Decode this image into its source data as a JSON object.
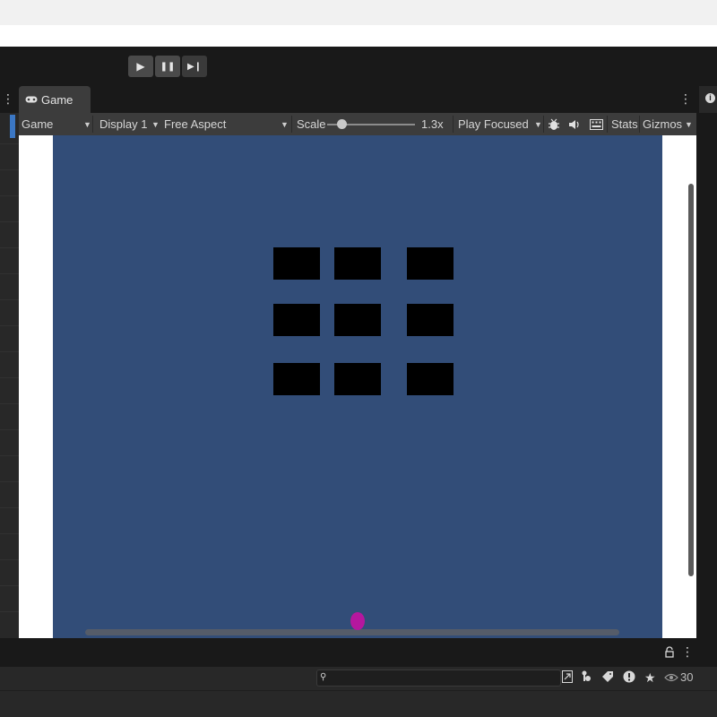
{
  "play_controls": {
    "play": "▶",
    "pause": "❚❚",
    "step": "▶❙"
  },
  "tab": {
    "label": "Game",
    "icon": "gamepad-icon"
  },
  "game_toolbar": {
    "view_select": "Game",
    "display_select": "Display 1",
    "aspect_select": "Free Aspect",
    "scale_label": "Scale",
    "scale_value": "1.3x",
    "play_mode_select": "Play Focused",
    "stats_label": "Stats",
    "gizmos_label": "Gizmos"
  },
  "scene": {
    "background_color": "#324d78",
    "brick_color": "#000000",
    "ball_color": "#b5179e",
    "paddle_color": "#555c69",
    "brick_rows": 3,
    "brick_columns": 3
  },
  "console": {
    "search_placeholder": "",
    "hidden_count": "30"
  }
}
